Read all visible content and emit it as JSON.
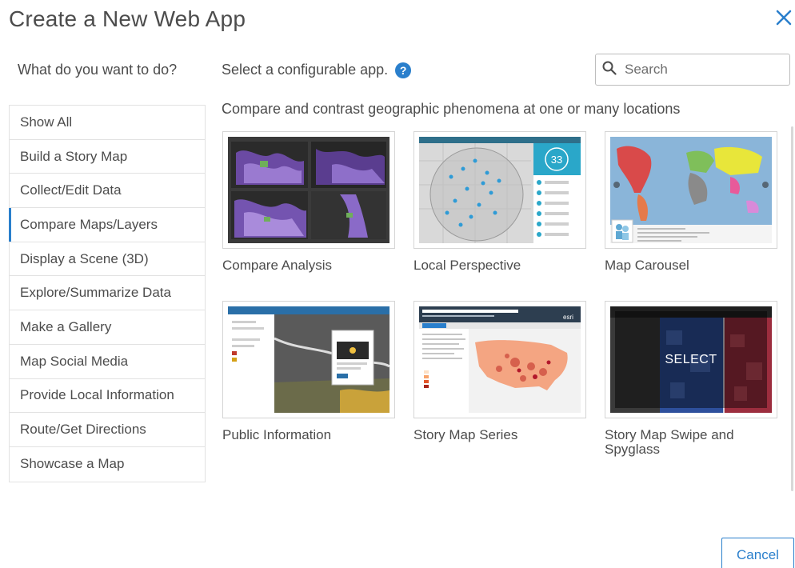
{
  "dialog": {
    "title": "Create a New Web App",
    "close_icon": "close-icon"
  },
  "left_heading": "What do you want to do?",
  "select_heading": "Select a configurable app.",
  "help_glyph": "?",
  "search": {
    "placeholder": "Search",
    "value": ""
  },
  "sidebar": {
    "items": [
      {
        "label": "Show All",
        "active": false
      },
      {
        "label": "Build a Story Map",
        "active": false
      },
      {
        "label": "Collect/Edit Data",
        "active": false
      },
      {
        "label": "Compare Maps/Layers",
        "active": true
      },
      {
        "label": "Display a Scene (3D)",
        "active": false
      },
      {
        "label": "Explore/Summarize Data",
        "active": false
      },
      {
        "label": "Make a Gallery",
        "active": false
      },
      {
        "label": "Map Social Media",
        "active": false
      },
      {
        "label": "Provide Local Information",
        "active": false
      },
      {
        "label": "Route/Get Directions",
        "active": false
      },
      {
        "label": "Showcase a Map",
        "active": false
      }
    ]
  },
  "section_title": "Compare and contrast geographic phenomena at one or many locations",
  "apps": [
    {
      "label": "Compare Analysis"
    },
    {
      "label": "Local Perspective",
      "thumb_counter": "33"
    },
    {
      "label": "Map Carousel"
    },
    {
      "label": "Public Information"
    },
    {
      "label": "Story Map Series",
      "thumb_brand": "esri"
    },
    {
      "label": "Story Map Swipe and Spyglass",
      "hover_text": "SELECT"
    }
  ],
  "footer": {
    "cancel_label": "Cancel"
  },
  "colors": {
    "accent": "#2a7fcc",
    "text": "#4c4c4c",
    "border": "#e2e2e2"
  }
}
